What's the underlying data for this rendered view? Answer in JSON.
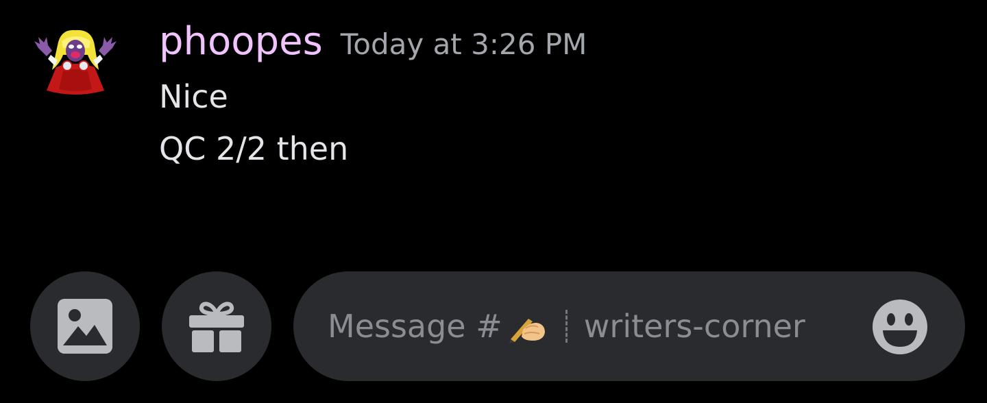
{
  "message": {
    "username": "phoopes",
    "timestamp": "Today at 3:26 PM",
    "lines": [
      "Nice",
      "QC 2/2 then"
    ],
    "avatar_icon": "jynx-pokemon-avatar",
    "username_color": "#f0c3ff"
  },
  "composer": {
    "image_button_icon": "image-icon",
    "gift_button_icon": "gift-icon",
    "placeholder_prefix": "Message #",
    "channel_emoji": "writing-hand-emoji",
    "placeholder_channel": "writers-corner",
    "emoji_button_icon": "smiley-face-icon"
  },
  "colors": {
    "background": "#000000",
    "input_background": "#292b2f",
    "timestamp": "#a3a6ab",
    "message_text": "#e3e5e8",
    "placeholder": "#8a8d93",
    "icon": "#b9bbbe"
  }
}
